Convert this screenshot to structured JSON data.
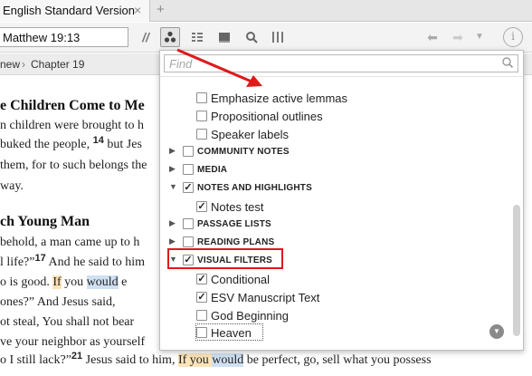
{
  "tab": {
    "title": "English Standard Version",
    "close_icon": "close-icon",
    "add_icon": "plus-icon"
  },
  "toolbar": {
    "reference": "Matthew 19:13",
    "parallel_label": "//",
    "icons": [
      "visual-filters-icon",
      "outline-icon",
      "book-icon",
      "search-icon",
      "columns-icon",
      "back-arrow-icon",
      "forward-arrow-icon",
      "more-icon",
      "info-icon"
    ],
    "info_label": "i"
  },
  "breadcrumb": {
    "book": "new",
    "separator": "›",
    "chapter": "Chapter 19"
  },
  "document": {
    "heading1": "e Children Come to Me",
    "heading2": "ch Young Man",
    "verse14": "14",
    "verse17": "17",
    "verse21": "21",
    "lines": {
      "l1": "n children were brought to h",
      "l2a": "buked the people, ",
      "l2b": " but Jes",
      "l3": "them, for to such belongs the",
      "l4": "way.",
      "l5": " behold, a man came up to h",
      "l6a": "l life?”",
      "l6b": " And he said to him",
      "l7a": "o is good. ",
      "l7b": "If",
      "l7c": " you ",
      "l7d": "would",
      "l7e": " e",
      "l8a": "ones?”",
      "l8b": " And Jesus said, ",
      "l9": "ot steal, You shall not bear",
      "l10": "ve your neighbor as yourself",
      "l11a": "o I still lack?”",
      "l11b": " Jesus said to him, ",
      "l11c": "If you ",
      "l11d": "would",
      "l11e": " be ",
      "l11f": "perfect, go, ",
      "l11g": "sell what you possess"
    }
  },
  "filter_panel": {
    "find_placeholder": "Find",
    "items": [
      {
        "label": "Emphasize active lemmas",
        "checked": false
      },
      {
        "label": "Propositional outlines",
        "checked": false
      },
      {
        "label": "Speaker labels",
        "checked": false
      },
      {
        "label": "COMMUNITY NOTES",
        "checked": false,
        "expanded": false
      },
      {
        "label": "MEDIA",
        "checked": false,
        "expanded": false
      },
      {
        "label": "NOTES AND HIGHLIGHTS",
        "checked": true,
        "expanded": true
      },
      {
        "label": "Notes test",
        "checked": true
      },
      {
        "label": "PASSAGE LISTS",
        "checked": false,
        "expanded": false
      },
      {
        "label": "READING PLANS",
        "checked": false,
        "expanded": false
      },
      {
        "label": "VISUAL FILTERS",
        "checked": true,
        "expanded": true
      },
      {
        "label": "Conditional",
        "checked": true
      },
      {
        "label": "ESV Manuscript Text",
        "checked": true
      },
      {
        "label": "God Beginning",
        "checked": false
      },
      {
        "label": "Heaven",
        "checked": false
      }
    ]
  },
  "colors": {
    "annotation_red": "#e0191b",
    "highlight_orange": "#fbe3b8",
    "highlight_blue": "#cfe0f2"
  }
}
